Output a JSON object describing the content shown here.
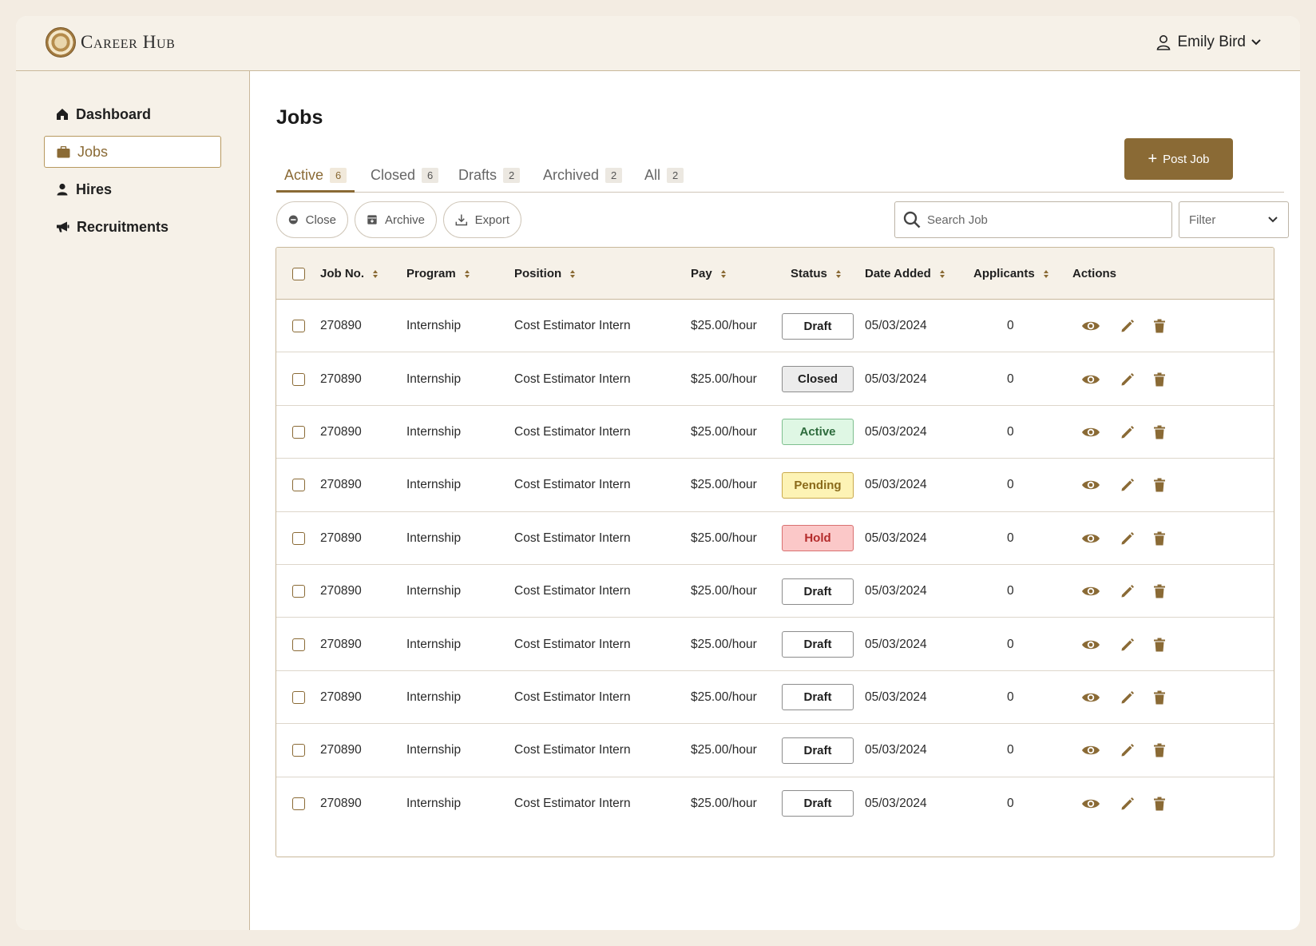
{
  "app": {
    "title": "Career Hub",
    "user_name": "Emily Bird",
    "accent": "#8a6a35"
  },
  "sidebar": {
    "items": [
      {
        "label": "Dashboard",
        "icon": "home-icon"
      },
      {
        "label": "Jobs",
        "icon": "briefcase-icon"
      },
      {
        "label": "Hires",
        "icon": "person-icon"
      },
      {
        "label": "Recruitments",
        "icon": "megaphone-icon"
      }
    ],
    "active": "Jobs"
  },
  "main": {
    "title": "Jobs",
    "post_button": "Post Job",
    "tabs": [
      {
        "label": "Active",
        "count": "6"
      },
      {
        "label": "Closed",
        "count": "6"
      },
      {
        "label": "Drafts",
        "count": "2"
      },
      {
        "label": "Archived",
        "count": "2"
      },
      {
        "label": "All",
        "count": "2"
      }
    ],
    "toolbar": {
      "close": "Close",
      "archive": "Archive",
      "export": "Export",
      "search_placeholder": "Search Job",
      "filter": "Filter"
    }
  },
  "table": {
    "columns": [
      "Job No.",
      "Program",
      "Position",
      "Pay",
      "Status",
      "Date Added",
      "Applicants",
      "Actions"
    ],
    "status_colors": {
      "Draft": {
        "bg": "#ffffff",
        "fg": "#1f1f1f",
        "border": "#8c8c8c"
      },
      "Closed": {
        "bg": "#ececec",
        "fg": "#1f1f1f",
        "border": "#8c8c8c"
      },
      "Active": {
        "bg": "#dff7e4",
        "fg": "#2d6b3c",
        "border": "#7fbf8f"
      },
      "Pending": {
        "bg": "#fdf3b5",
        "fg": "#8a6a1a",
        "border": "#c9a94b"
      },
      "Hold": {
        "bg": "#fbc8c8",
        "fg": "#b42b2b",
        "border": "#d97070"
      }
    },
    "rows": [
      {
        "job_no": "270890",
        "program": "Internship",
        "position": "Cost Estimator Intern",
        "pay": "$25.00/hour",
        "status": "Draft",
        "date": "05/03/2024",
        "applicants": "0"
      },
      {
        "job_no": "270890",
        "program": "Internship",
        "position": "Cost Estimator Intern",
        "pay": "$25.00/hour",
        "status": "Closed",
        "date": "05/03/2024",
        "applicants": "0"
      },
      {
        "job_no": "270890",
        "program": "Internship",
        "position": "Cost Estimator Intern",
        "pay": "$25.00/hour",
        "status": "Active",
        "date": "05/03/2024",
        "applicants": "0"
      },
      {
        "job_no": "270890",
        "program": "Internship",
        "position": "Cost Estimator Intern",
        "pay": "$25.00/hour",
        "status": "Pending",
        "date": "05/03/2024",
        "applicants": "0"
      },
      {
        "job_no": "270890",
        "program": "Internship",
        "position": "Cost Estimator Intern",
        "pay": "$25.00/hour",
        "status": "Hold",
        "date": "05/03/2024",
        "applicants": "0"
      },
      {
        "job_no": "270890",
        "program": "Internship",
        "position": "Cost Estimator Intern",
        "pay": "$25.00/hour",
        "status": "Draft",
        "date": "05/03/2024",
        "applicants": "0"
      },
      {
        "job_no": "270890",
        "program": "Internship",
        "position": "Cost Estimator Intern",
        "pay": "$25.00/hour",
        "status": "Draft",
        "date": "05/03/2024",
        "applicants": "0"
      },
      {
        "job_no": "270890",
        "program": "Internship",
        "position": "Cost Estimator Intern",
        "pay": "$25.00/hour",
        "status": "Draft",
        "date": "05/03/2024",
        "applicants": "0"
      },
      {
        "job_no": "270890",
        "program": "Internship",
        "position": "Cost Estimator Intern",
        "pay": "$25.00/hour",
        "status": "Draft",
        "date": "05/03/2024",
        "applicants": "0"
      },
      {
        "job_no": "270890",
        "program": "Internship",
        "position": "Cost Estimator Intern",
        "pay": "$25.00/hour",
        "status": "Draft",
        "date": "05/03/2024",
        "applicants": "0"
      }
    ]
  }
}
